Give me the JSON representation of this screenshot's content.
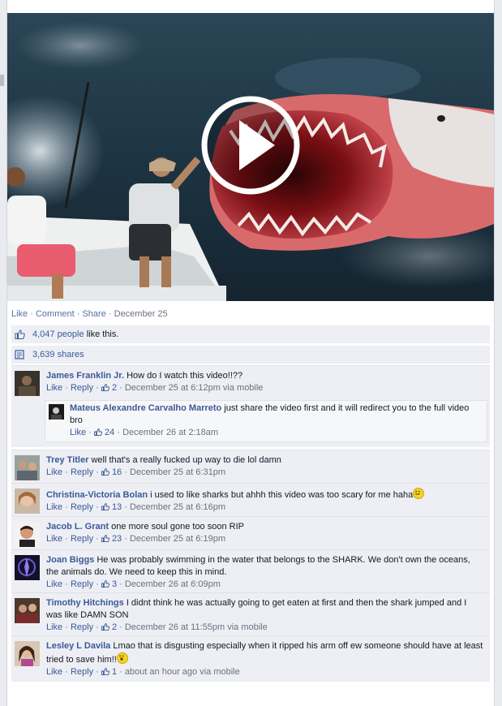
{
  "post": {
    "action_like": "Like",
    "action_comment": "Comment",
    "action_share": "Share",
    "date": "December 25",
    "likes_count": "4,047 people",
    "likes_suffix": "like this.",
    "shares_count": "3,639 shares"
  },
  "icons": {
    "play": "play-icon",
    "thumb": "thumbs-up-icon",
    "share": "share-icon",
    "emoji_smile": "smiley-emoji",
    "emoji_shock": "shocked-emoji"
  },
  "colors": {
    "link": "#3b5998",
    "meta": "#6a7180",
    "ufi_bg": "#edeff4"
  },
  "comments": [
    {
      "author": "James Franklin Jr.",
      "text": "How do I watch this video!!??",
      "like": "Like",
      "reply": "Reply",
      "likes": "2",
      "time": "December 25 at 6:12pm via mobile"
    },
    {
      "author": "Trey Titler",
      "text": "well that's a really fucked up way to die lol damn",
      "like": "Like",
      "reply": "Reply",
      "likes": "16",
      "time": "December 25 at 6:31pm"
    },
    {
      "author": "Christina-Victoria Bolan",
      "text": "i used to like sharks but ahhh this video was too scary for me haha",
      "like": "Like",
      "reply": "Reply",
      "likes": "13",
      "time": "December 25 at 6:16pm"
    },
    {
      "author": "Jacob L. Grant",
      "text": "one more soul gone too soon RIP",
      "like": "Like",
      "reply": "Reply",
      "likes": "23",
      "time": "December 25 at 6:19pm"
    },
    {
      "author": "Joan Biggs",
      "text": "He was probably swimming in the water that belongs to the SHARK. We don't own the oceans, the animals do. We need to keep this in mind.",
      "like": "Like",
      "reply": "Reply",
      "likes": "3",
      "time": "December 26 at 6:09pm"
    },
    {
      "author": "Timothy Hitchings",
      "text": "I didnt think he was actually going to get eaten at first and then the shark jumped and I was like DAMN SON",
      "like": "Like",
      "reply": "Reply",
      "likes": "2",
      "time": "December 26 at 11:55pm via mobile"
    },
    {
      "author": "Lesley L Davila",
      "text": "Lmao that is disgusting especially when it ripped his arm off ew someone should have at least tried to save him!!",
      "like": "Like",
      "reply": "Reply",
      "likes": "1",
      "time": "about an hour ago via mobile"
    }
  ],
  "reply": {
    "author": "Mateus Alexandre Carvalho Marreto",
    "text": "just share the video first and it will redirect you to the full video bro",
    "like": "Like",
    "likes": "24",
    "time": "December 26 at 2:18am"
  }
}
